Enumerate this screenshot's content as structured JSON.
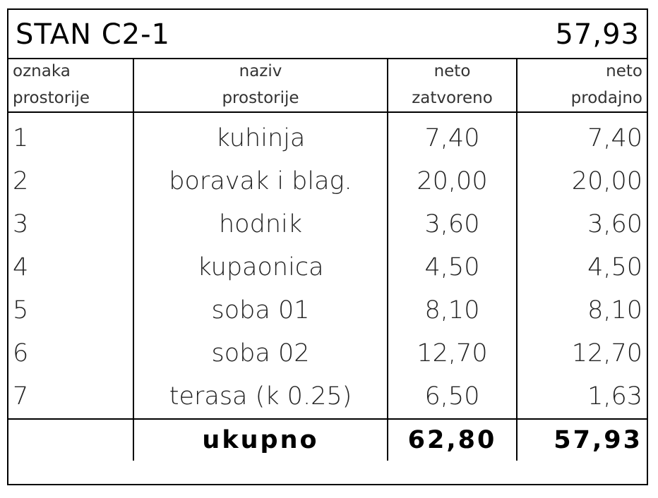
{
  "title": {
    "name": "STAN C2-1",
    "total": "57,93"
  },
  "columns": [
    {
      "line1": "oznaka",
      "line2": "prostorije"
    },
    {
      "line1": "naziv",
      "line2": "prostorije"
    },
    {
      "line1": "neto",
      "line2": "zatvoreno"
    },
    {
      "line1": "neto",
      "line2": "prodajno"
    }
  ],
  "rows": [
    {
      "no": "1",
      "name": "kuhinja",
      "closed": "7,40",
      "sale": "7,40"
    },
    {
      "no": "2",
      "name": "boravak i blag.",
      "closed": "20,00",
      "sale": "20,00"
    },
    {
      "no": "3",
      "name": "hodnik",
      "closed": "3,60",
      "sale": "3,60"
    },
    {
      "no": "4",
      "name": "kupaonica",
      "closed": "4,50",
      "sale": "4,50"
    },
    {
      "no": "5",
      "name": "soba 01",
      "closed": "8,10",
      "sale": "8,10"
    },
    {
      "no": "6",
      "name": "soba 02",
      "closed": "12,70",
      "sale": "12,70"
    },
    {
      "no": "7",
      "name": "terasa (k 0.25)",
      "closed": "6,50",
      "sale": "1,63"
    }
  ],
  "footer": {
    "label": "ukupno",
    "closed": "62,80",
    "sale": "57,93"
  }
}
